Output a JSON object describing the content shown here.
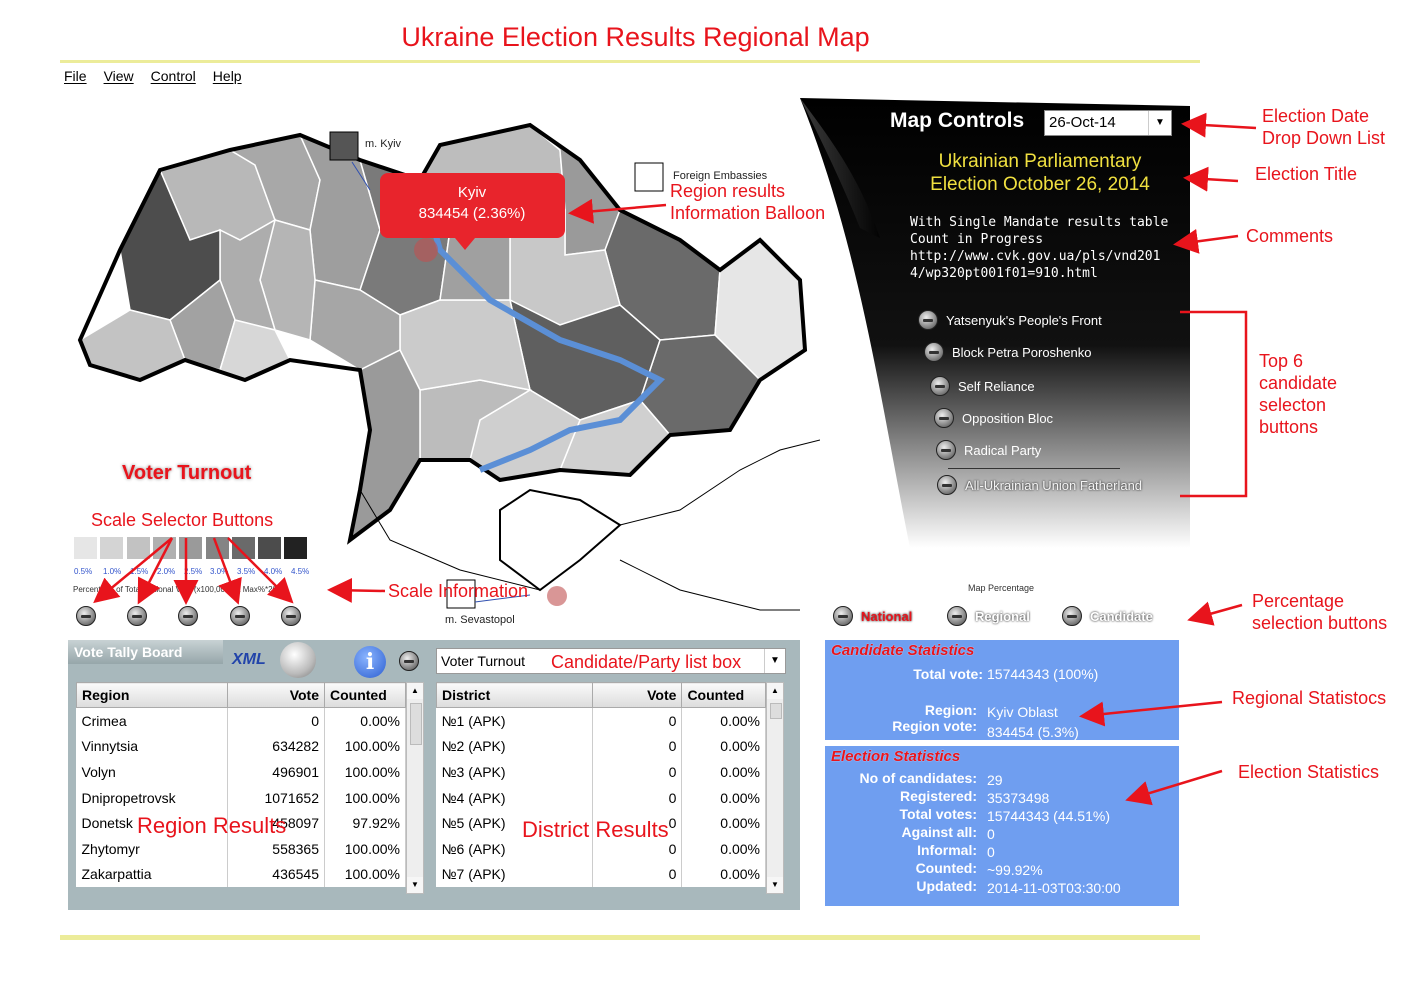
{
  "page_title": "Ukraine Election Results Regional Map",
  "menu": [
    "File",
    "View",
    "Control",
    "Help"
  ],
  "map": {
    "kyiv_city_label": "m. Kyiv",
    "embassies_label": "Foreign Embassies",
    "sevastopol_label": "m. Sevastopol",
    "balloon_region": "Kyiv",
    "balloon_value": "834454 (2.36%)"
  },
  "controls": {
    "title": "Map Controls",
    "date_value": "26-Oct-14",
    "election_title_line1": "Ukrainian Parliamentary",
    "election_title_line2": "Election October 26, 2014",
    "comment_lines": [
      "With Single Mandate results table",
      "Count in Progress",
      "http://www.cvk.gov.ua/pls/vnd201",
      "4/wp320pt001f01=910.html"
    ],
    "candidates": [
      "Yatsenyuk's People's Front",
      "Block Petra Poroshenko",
      "Self Reliance",
      "Opposition Bloc",
      "Radical Party",
      "All-Ukrainian Union Fatherland"
    ],
    "map_percentage_label": "Map Percentage",
    "percentage_buttons": [
      "National",
      "Regional",
      "Candidate"
    ]
  },
  "scale": {
    "heading": "Voter Turnout",
    "ticks": [
      "0.5%",
      "1.0%",
      "1.5%",
      "2.0%",
      "2.5%",
      "3.0%",
      "3.5%",
      "4.0%",
      "4.5%"
    ],
    "info": "Percentage of Total National Vote (x100,000. at Max%*2000)",
    "swatch_colors": [
      "#e6e6e6",
      "#d4d4d4",
      "#c2c2c2",
      "#b0b0b0",
      "#9a9a9a",
      "#848484",
      "#6a6a6a",
      "#4c4c4c",
      "#222222"
    ]
  },
  "tally": {
    "tab_label": "Vote Tally Board",
    "xml_label": "XML",
    "info_glyph": "i",
    "list_select_value": "Voter Turnout",
    "region_headers": [
      "Region",
      "Vote",
      "Counted"
    ],
    "region_rows": [
      [
        "Crimea",
        "0",
        "0.00%"
      ],
      [
        "Vinnytsia",
        "634282",
        "100.00%"
      ],
      [
        "Volyn",
        "496901",
        "100.00%"
      ],
      [
        "Dnipropetrovsk",
        "1071652",
        "100.00%"
      ],
      [
        "Donetsk",
        "458097",
        "97.92%"
      ],
      [
        "Zhytomyr",
        "558365",
        "100.00%"
      ],
      [
        "Zakarpattia",
        "436545",
        "100.00%"
      ]
    ],
    "district_headers": [
      "District",
      "Vote",
      "Counted"
    ],
    "district_rows": [
      [
        "№1 (APK)",
        "0",
        "0.00%"
      ],
      [
        "№2 (APK)",
        "0",
        "0.00%"
      ],
      [
        "№3 (APK)",
        "0",
        "0.00%"
      ],
      [
        "№4 (APK)",
        "0",
        "0.00%"
      ],
      [
        "№5 (APK)",
        "0",
        "0.00%"
      ],
      [
        "№6 (APK)",
        "0",
        "0.00%"
      ],
      [
        "№7 (APK)",
        "0",
        "0.00%"
      ]
    ]
  },
  "candidate_stats": {
    "heading": "Candidate Statistics",
    "total_vote_label": "Total vote:",
    "total_vote_value": "15744343 (100%)",
    "region_label": "Region:",
    "region_value": "Kyiv Oblast",
    "region_vote_label": "Region vote:",
    "region_vote_value": "834454  (5.3%)"
  },
  "election_stats": {
    "heading": "Election Statistics",
    "rows": [
      [
        "No of candidates:",
        "29"
      ],
      [
        "Registered:",
        "35373498"
      ],
      [
        "Total votes:",
        "15744343  (44.51%)"
      ],
      [
        "Against all:",
        "0"
      ],
      [
        "Informal:",
        "0"
      ],
      [
        "Counted:",
        "~99.92%"
      ],
      [
        "Updated:",
        "2014-11-03T03:30:00"
      ]
    ]
  },
  "annotations": {
    "balloon_line1": "Region results",
    "balloon_line2": "Information Balloon",
    "date_line1": "Election Date",
    "date_line2": "Drop Down List",
    "election_title": "Election Title",
    "comments": "Comments",
    "top6_lines": [
      "Top 6",
      "candidate",
      "selecton",
      "buttons"
    ],
    "scale_selector": "Scale Selector Buttons",
    "scale_information": "Scale Information",
    "candidate_list_box": "Candidate/Party list box",
    "percentage_line1": "Percentage",
    "percentage_line2": "selection buttons",
    "regional_stats": "Regional Statistocs",
    "election_stats": "Election Statistics",
    "region_results": "Region Results",
    "district_results": "District Results"
  }
}
